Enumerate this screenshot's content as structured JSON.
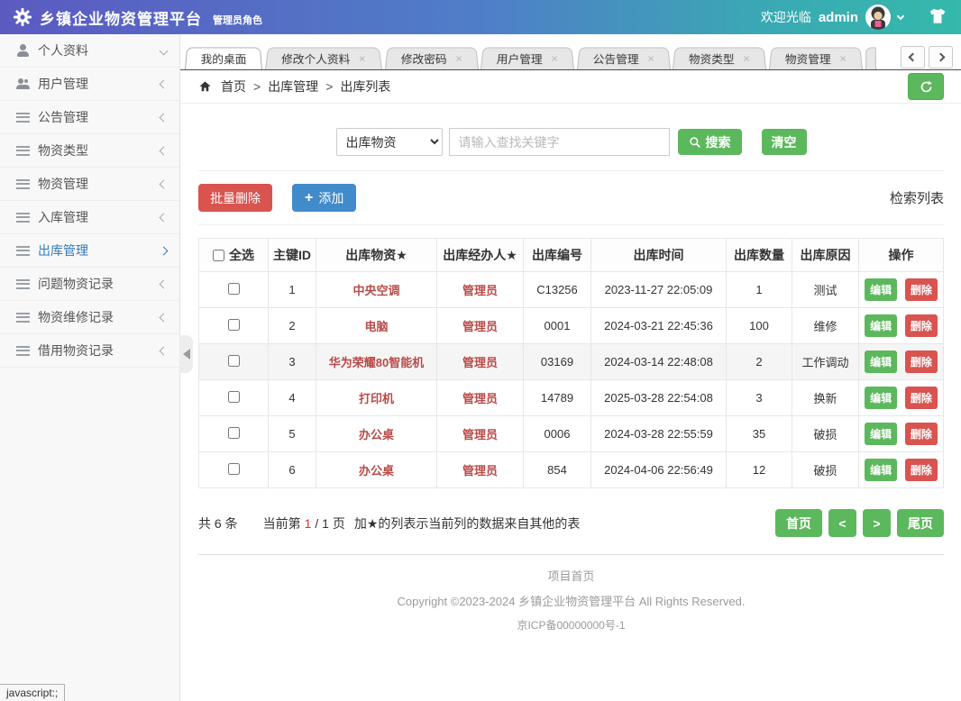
{
  "header": {
    "title": "乡镇企业物资管理平台",
    "role": "管理员角色",
    "welcome": "欢迎光临",
    "username": "admin"
  },
  "sidebar": {
    "items": [
      {
        "label": "个人资料",
        "icon": "user",
        "chevron": "down",
        "active": false
      },
      {
        "label": "用户管理",
        "icon": "users",
        "chevron": "left",
        "active": false
      },
      {
        "label": "公告管理",
        "icon": "list",
        "chevron": "left",
        "active": false
      },
      {
        "label": "物资类型",
        "icon": "list",
        "chevron": "left",
        "active": false
      },
      {
        "label": "物资管理",
        "icon": "list",
        "chevron": "left",
        "active": false
      },
      {
        "label": "入库管理",
        "icon": "list",
        "chevron": "left",
        "active": false
      },
      {
        "label": "出库管理",
        "icon": "list",
        "chevron": "right",
        "active": true
      },
      {
        "label": "问题物资记录",
        "icon": "list",
        "chevron": "left",
        "active": false
      },
      {
        "label": "物资维修记录",
        "icon": "list",
        "chevron": "left",
        "active": false
      },
      {
        "label": "借用物资记录",
        "icon": "list",
        "chevron": "left",
        "active": false
      }
    ]
  },
  "tabs": {
    "items": [
      {
        "label": "我的桌面",
        "closable": false,
        "active": true
      },
      {
        "label": "修改个人资料",
        "closable": true,
        "active": false
      },
      {
        "label": "修改密码",
        "closable": true,
        "active": false
      },
      {
        "label": "用户管理",
        "closable": true,
        "active": false
      },
      {
        "label": "公告管理",
        "closable": true,
        "active": false
      },
      {
        "label": "物资类型",
        "closable": true,
        "active": false
      },
      {
        "label": "物资管理",
        "closable": true,
        "active": false
      }
    ],
    "close_glyph": "×"
  },
  "breadcrumb": {
    "items": [
      "首页",
      "出库管理",
      "出库列表"
    ],
    "separator": ">"
  },
  "search": {
    "select_value": "出库物资",
    "select_options": [
      "出库物资"
    ],
    "input_value": "",
    "input_placeholder": "请输入查找关键字",
    "search_label": "搜索",
    "clear_label": "清空"
  },
  "toolbar": {
    "batch_delete_label": "批量删除",
    "add_label": "添加",
    "list_title": "检索列表"
  },
  "table": {
    "headers": {
      "select_all": "全选",
      "id": "主键ID",
      "item": "出库物资★",
      "operator": "出库经办人★",
      "code": "出库编号",
      "time": "出库时间",
      "qty": "出库数量",
      "reason": "出库原因",
      "ops": "操作"
    },
    "edit_label": "编辑",
    "delete_label": "删除",
    "rows": [
      {
        "id": "1",
        "item": "中央空调",
        "operator": "管理员",
        "code": "C13256",
        "time": "2023-11-27 22:05:09",
        "qty": "1",
        "reason": "测试",
        "highlighted": false
      },
      {
        "id": "2",
        "item": "电脑",
        "operator": "管理员",
        "code": "0001",
        "time": "2024-03-21 22:45:36",
        "qty": "100",
        "reason": "维修",
        "highlighted": false
      },
      {
        "id": "3",
        "item": "华为荣耀80智能机",
        "operator": "管理员",
        "code": "03169",
        "time": "2024-03-14 22:48:08",
        "qty": "2",
        "reason": "工作调动",
        "highlighted": true
      },
      {
        "id": "4",
        "item": "打印机",
        "operator": "管理员",
        "code": "14789",
        "time": "2025-03-28 22:54:08",
        "qty": "3",
        "reason": "换新",
        "highlighted": false
      },
      {
        "id": "5",
        "item": "办公桌",
        "operator": "管理员",
        "code": "0006",
        "time": "2024-03-28 22:55:59",
        "qty": "35",
        "reason": "破损",
        "highlighted": false
      },
      {
        "id": "6",
        "item": "办公桌",
        "operator": "管理员",
        "code": "854",
        "time": "2024-04-06 22:56:49",
        "qty": "12",
        "reason": "破损",
        "highlighted": false
      }
    ]
  },
  "pagination": {
    "total_text": "共 6 条",
    "current_prefix": "当前第",
    "current_page": "1",
    "pages_suffix": "/ 1 页",
    "note": "加★的列表示当前列的数据来自其他的表",
    "first_label": "首页",
    "prev_label": "<",
    "next_label": ">",
    "last_label": "尾页"
  },
  "footer": {
    "home_link": "项目首页",
    "copyright": "Copyright ©2023-2024 乡镇企业物资管理平台 All Rights Reserved.",
    "icp": "京ICP备00000000号-1"
  },
  "statusbar": {
    "text": "javascript:;"
  },
  "colors": {
    "green": "#5cb85c",
    "red": "#d9534f",
    "blue": "#428bca",
    "active_link": "#337ab7",
    "table_link_red": "#b94a48",
    "header_gradient_start": "#5c5ac1",
    "header_gradient_end": "#35b9ab"
  }
}
